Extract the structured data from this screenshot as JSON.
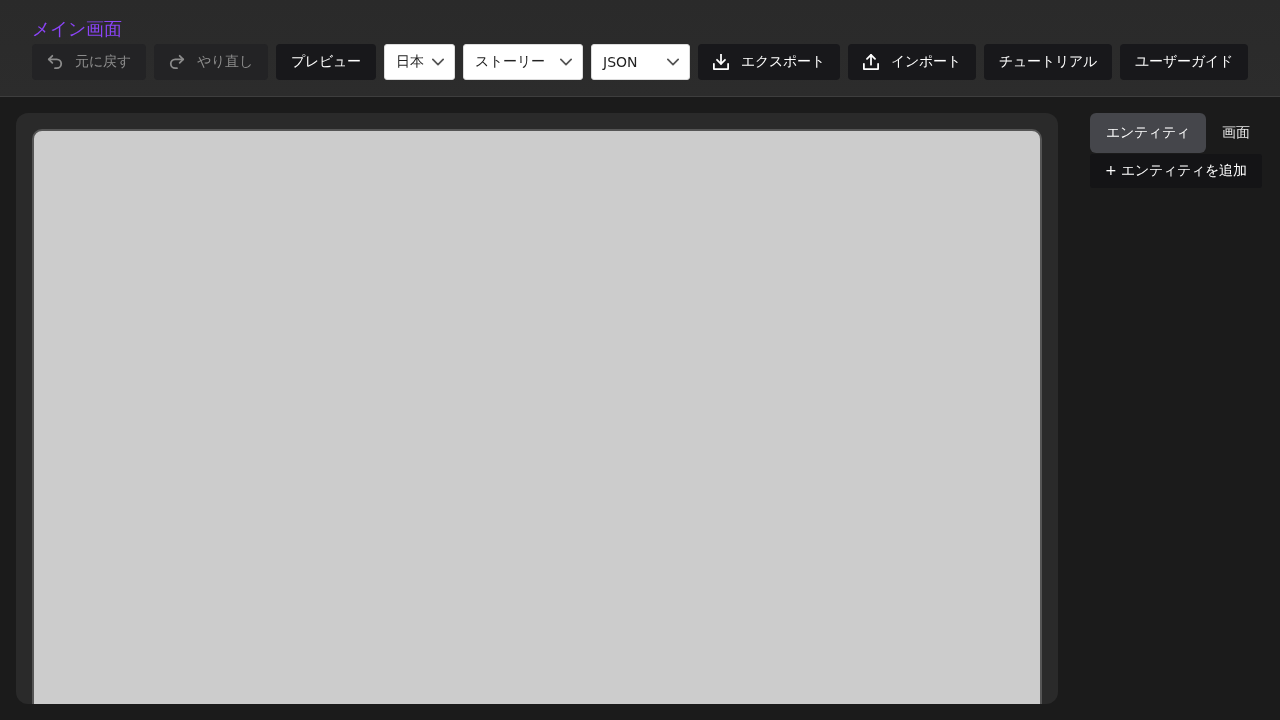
{
  "header": {
    "title": "メイン画面",
    "toolbar": {
      "undo": {
        "label": "元に戻す",
        "disabled": true
      },
      "redo": {
        "label": "やり直し",
        "disabled": true
      },
      "preview": {
        "label": "プレビュー",
        "disabled": false
      },
      "selects": [
        {
          "value": "日本"
        },
        {
          "value": "ストーリー"
        },
        {
          "value": "JSON"
        }
      ],
      "export": {
        "label": "エクスポート",
        "disabled": false
      },
      "import": {
        "label": "インポート",
        "disabled": false
      },
      "tutorial": {
        "label": "チュートリアル",
        "disabled": false
      },
      "user_guide": {
        "label": "ユーザーガイド",
        "disabled": false
      }
    }
  },
  "sidebar": {
    "tabs": [
      {
        "label": "エンティティ",
        "selected": true
      },
      {
        "label": "画面",
        "selected": false
      }
    ],
    "add_button": {
      "label": "+ エンティティを追加"
    }
  }
}
